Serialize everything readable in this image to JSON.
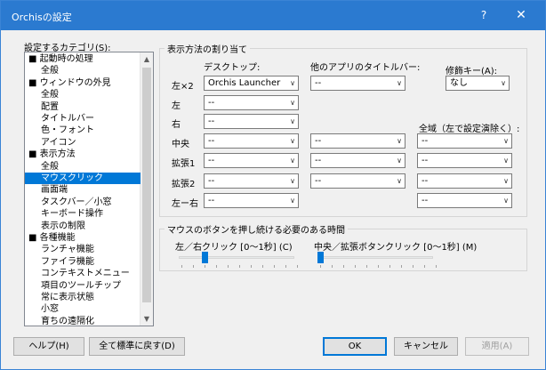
{
  "window": {
    "title": "Orchisの設定",
    "help_glyph": "?",
    "close_glyph": "✕"
  },
  "sidebar": {
    "label": "設定するカテゴリ(S):",
    "items": [
      {
        "label": "■ 起動時の処理"
      },
      {
        "label": "全般"
      },
      {
        "label": "■ ウィンドウの外見"
      },
      {
        "label": "全般"
      },
      {
        "label": "配置"
      },
      {
        "label": "タイトルバー"
      },
      {
        "label": "色・フォント"
      },
      {
        "label": "アイコン"
      },
      {
        "label": "■ 表示方法"
      },
      {
        "label": "全般"
      },
      {
        "label": "マウスクリック",
        "selected": true
      },
      {
        "label": "画面端"
      },
      {
        "label": "タスクバー／小窓"
      },
      {
        "label": "キーボード操作"
      },
      {
        "label": "表示の制限"
      },
      {
        "label": "■ 各種機能"
      },
      {
        "label": "ランチャ機能"
      },
      {
        "label": "ファイラ機能"
      },
      {
        "label": "コンテキストメニュー"
      },
      {
        "label": "項目のツールチップ"
      },
      {
        "label": "常に表示状態"
      },
      {
        "label": "小窓"
      },
      {
        "label": "育ちの遠隔化"
      }
    ]
  },
  "assign": {
    "group_title": "表示方法の割り当て",
    "col_desktop": "デスクトップ:",
    "col_titlebar": "他のアプリのタイトルバー:",
    "col_modifier": "修飾キー(A):",
    "modifier_value": "なし",
    "global_label": "全域（左で設定演除く）:",
    "rows": [
      {
        "label": "左×2",
        "desktop": "Orchis Launcher",
        "titlebar": "--"
      },
      {
        "label": "左",
        "desktop": "--"
      },
      {
        "label": "右",
        "desktop": "--"
      },
      {
        "label": "中央",
        "desktop": "--",
        "titlebar": "--",
        "global": "--"
      },
      {
        "label": "拡張1",
        "desktop": "--",
        "titlebar": "--",
        "global": "--"
      },
      {
        "label": "拡張2",
        "desktop": "--",
        "titlebar": "--",
        "global": "--"
      },
      {
        "label": "左ー右",
        "desktop": "--",
        "global": "--"
      }
    ]
  },
  "hold": {
    "group_title": "マウスのボタンを押し続ける必要のある時間",
    "left_label": "左／右クリック [0〜1秒] (C)",
    "middle_label": "中央／拡張ボタンクリック [0〜1秒] (M)",
    "left_value": 0.2,
    "middle_value": 0.0
  },
  "footer": {
    "help": "ヘルプ(H)",
    "reset": "全て標準に戻す(D)",
    "ok": "OK",
    "cancel": "キャンセル",
    "apply": "適用(A)"
  },
  "colors": {
    "titlebar": "#2b7ad0",
    "selection": "#0078d7"
  }
}
